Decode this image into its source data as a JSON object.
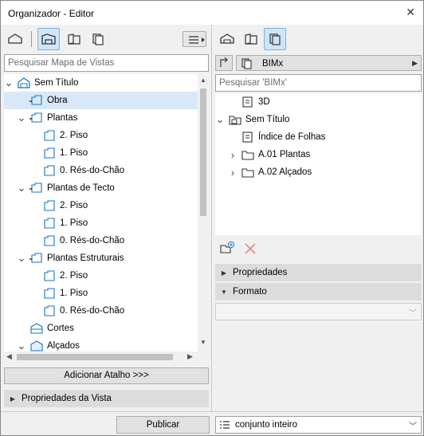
{
  "window": {
    "title": "Organizador - Editor",
    "close_glyph": "✕"
  },
  "left": {
    "search_placeholder": "Pesquisar Mapa de Vistas",
    "tree": [
      {
        "label": "Sem Título",
        "depth": 0,
        "toggle": "v",
        "icon": "project-icon"
      },
      {
        "label": "Obra",
        "depth": 1,
        "toggle": "",
        "icon": "view-folder-icon",
        "selected": true
      },
      {
        "label": "Plantas",
        "depth": 1,
        "toggle": "v",
        "icon": "view-folder-icon"
      },
      {
        "label": "2. Piso",
        "depth": 2,
        "toggle": "",
        "icon": "view-icon"
      },
      {
        "label": "1. Piso",
        "depth": 2,
        "toggle": "",
        "icon": "view-icon"
      },
      {
        "label": "0. Rés-do-Chão",
        "depth": 2,
        "toggle": "",
        "icon": "view-icon"
      },
      {
        "label": "Plantas de Tecto",
        "depth": 1,
        "toggle": "v",
        "icon": "view-folder-icon"
      },
      {
        "label": "2. Piso",
        "depth": 2,
        "toggle": "",
        "icon": "view-icon"
      },
      {
        "label": "1. Piso",
        "depth": 2,
        "toggle": "",
        "icon": "view-icon"
      },
      {
        "label": "0. Rés-do-Chão",
        "depth": 2,
        "toggle": "",
        "icon": "view-icon"
      },
      {
        "label": "Plantas Estruturais",
        "depth": 1,
        "toggle": "v",
        "icon": "view-folder-icon"
      },
      {
        "label": "2. Piso",
        "depth": 2,
        "toggle": "",
        "icon": "view-icon"
      },
      {
        "label": "1. Piso",
        "depth": 2,
        "toggle": "",
        "icon": "view-icon"
      },
      {
        "label": "0. Rés-do-Chão",
        "depth": 2,
        "toggle": "",
        "icon": "view-icon"
      },
      {
        "label": "Cortes",
        "depth": 1,
        "toggle": "",
        "icon": "section-icon"
      },
      {
        "label": "Alçados",
        "depth": 1,
        "toggle": "v",
        "icon": "elevation-icon"
      }
    ],
    "add_shortcut_label": "Adicionar Atalho >>>",
    "view_properties_label": "Propriedades da Vista"
  },
  "right": {
    "set_name": "BIMx",
    "search_placeholder": "Pesquisar 'BIMx'",
    "tree": [
      {
        "label": "3D",
        "depth": 1,
        "toggle": "",
        "icon": "publish-item-icon"
      },
      {
        "label": "Sem Título",
        "depth": 0,
        "toggle": "v",
        "icon": "publish-folder-icon"
      },
      {
        "label": "Índice de Folhas",
        "depth": 1,
        "toggle": "",
        "icon": "publish-item-icon"
      },
      {
        "label": "A.01 Plantas",
        "depth": 1,
        "toggle": ">",
        "icon": "folder-icon"
      },
      {
        "label": "A.02 Alçados",
        "depth": 1,
        "toggle": ">",
        "icon": "folder-icon"
      }
    ],
    "properties_label": "Propriedades",
    "format_label": "Formato",
    "format_value": ""
  },
  "bottom": {
    "publish_label": "Publicar",
    "set_value": "conjunto inteiro"
  },
  "colors": {
    "accent": "#1a73c8",
    "selected": "#d9e8f7",
    "delete": "#e05a4e"
  }
}
